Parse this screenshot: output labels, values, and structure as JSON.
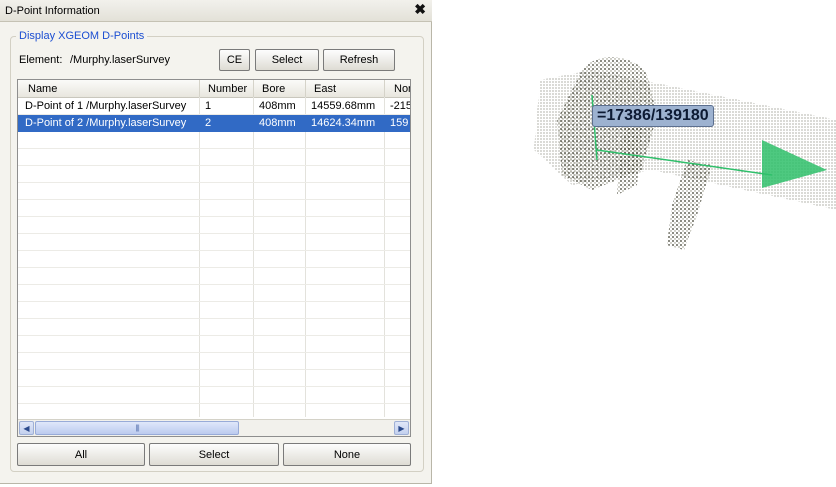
{
  "window": {
    "title": "D-Point Information",
    "close_glyph": "✖"
  },
  "group": {
    "label": "Display XGEOM D-Points"
  },
  "element": {
    "label": "Element:",
    "value": "/Murphy.laserSurvey"
  },
  "top_buttons": {
    "ce": "CE",
    "select": "Select",
    "refresh": "Refresh"
  },
  "table": {
    "columns": [
      "Name",
      "Number",
      "Bore",
      "East",
      "Nor"
    ],
    "rows": [
      {
        "name": "D-Point of 1  /Murphy.laserSurvey",
        "number": "1",
        "bore": "408mm",
        "east": "14559.68mm",
        "north": "-215"
      },
      {
        "name": "D-Point of 2  /Murphy.laserSurvey",
        "number": "2",
        "bore": "408mm",
        "east": "14624.34mm",
        "north": "159"
      }
    ],
    "selected_row": 2,
    "scroll": {
      "left_arrow": "◀",
      "right_arrow": "▶",
      "thumb_grip": "||||"
    }
  },
  "bottom_buttons": {
    "all": "All",
    "select": "Select",
    "none": "None"
  },
  "viewport": {
    "dpoint_label": "=17386/139180",
    "arrow_color": "#2fbf6a",
    "pointcloud_color": "#3a3a2a"
  }
}
